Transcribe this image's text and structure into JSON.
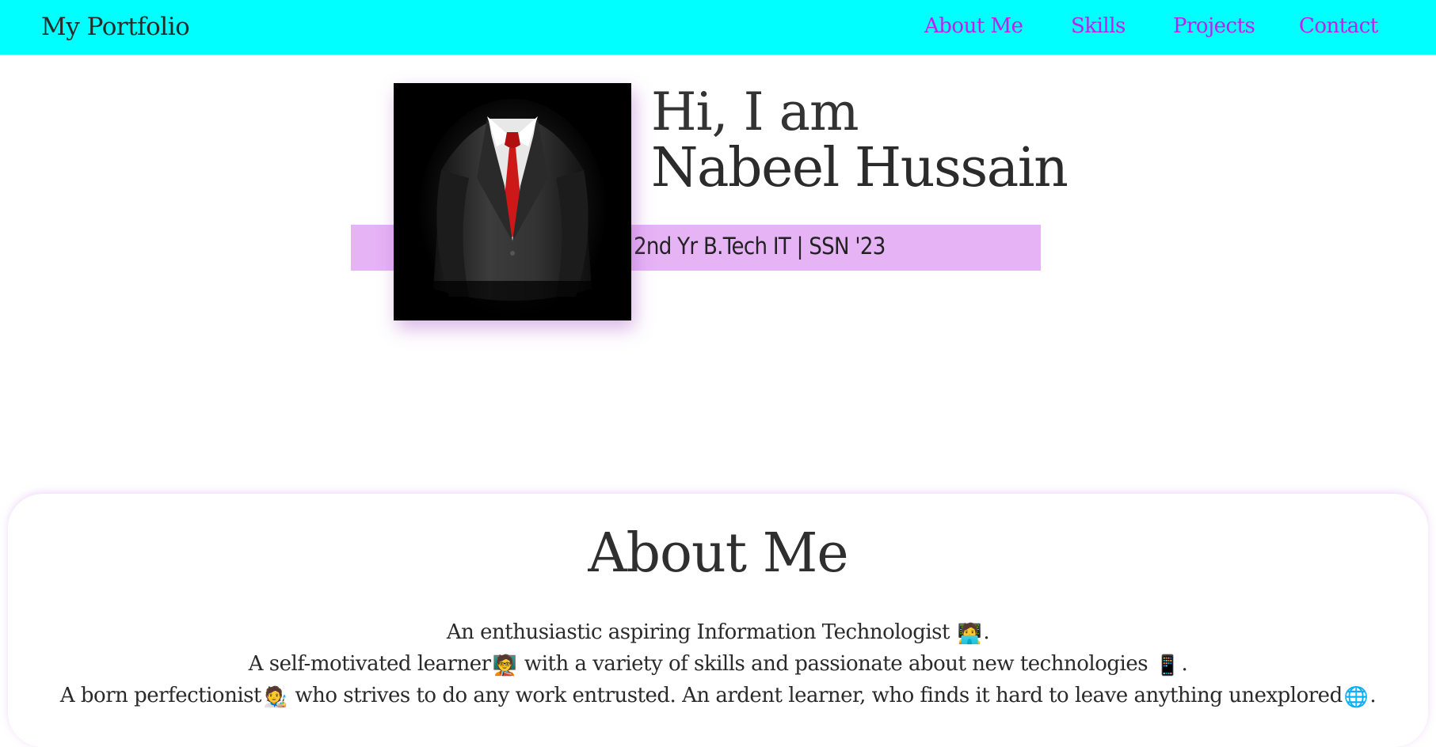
{
  "nav": {
    "brand": "My Portfolio",
    "links": [
      "About Me",
      "Skills",
      "Projects",
      "Contact"
    ],
    "bg_color": "#00ffff",
    "link_color": "#c020ee"
  },
  "hero": {
    "greeting": "Hi, I am",
    "name": "Nabeel Hussain",
    "tagline": "2nd Yr B.Tech IT | SSN '23",
    "tagline_bg_color": "#e6b3f5",
    "portrait_icon": "person-in-suit-photo"
  },
  "about": {
    "title": "About Me",
    "lines": [
      {
        "text": "An enthusiastic aspiring Information Technologist ",
        "emoji": "🧑‍💻",
        "after": "."
      },
      {
        "text": "A self-motivated learner",
        "emoji": "🧑‍🏫",
        "after": " with a variety of skills and passionate about new technologies ",
        "emoji2": "📱",
        "after2": "."
      },
      {
        "text": "A born perfectionist",
        "emoji": "🧑‍🎨",
        "after": " who strives to do any work entrusted. An ardent learner, who finds it hard to leave anything unexplored",
        "emoji2": "🌐",
        "after2": "."
      }
    ]
  }
}
